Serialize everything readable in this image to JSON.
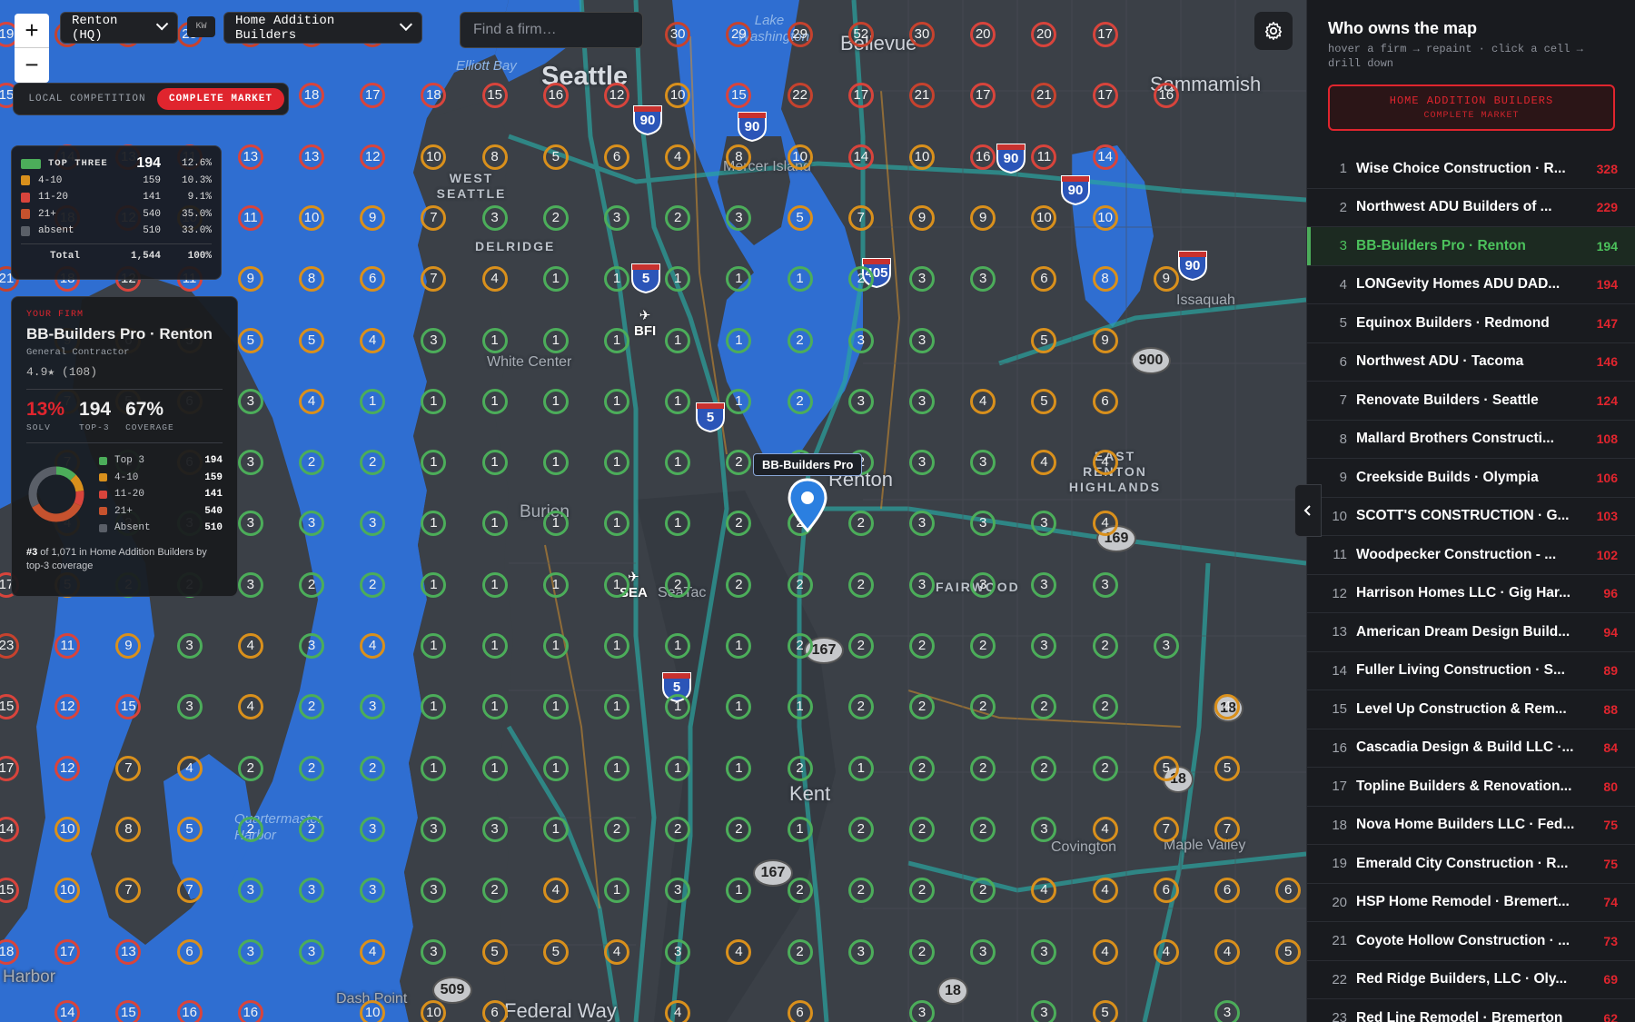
{
  "map": {
    "region_selector": "Renton (HQ)",
    "kw_badge": "KW",
    "category_selector": "Home Addition Builders",
    "search_placeholder": "Find a firm…",
    "mode_local": "LOCAL COMPETITION",
    "mode_complete": "COMPLETE MARKET",
    "zoom_in": "+",
    "zoom_out": "−",
    "pin_label": "BB-Builders Pro",
    "places": [
      {
        "name": "Seattle",
        "cls": "big"
      },
      {
        "name": "Bellevue",
        "cls": "med"
      },
      {
        "name": "Sammamish",
        "cls": "med"
      },
      {
        "name": "Renton",
        "cls": "med"
      },
      {
        "name": "Burien",
        "cls": "faint"
      },
      {
        "name": "Kent",
        "cls": "med"
      },
      {
        "name": "Issaquah",
        "cls": "faint"
      },
      {
        "name": "WEST SEATTLE",
        "cls": "small"
      },
      {
        "name": "DELRIDGE",
        "cls": "small"
      },
      {
        "name": "EAST RENTON HIGHLANDS",
        "cls": "small"
      },
      {
        "name": "FAIRWOOD",
        "cls": "small"
      },
      {
        "name": "White Center",
        "cls": "faint"
      },
      {
        "name": "Mercer Island",
        "cls": "faint"
      },
      {
        "name": "SeaTac",
        "cls": "faint"
      },
      {
        "name": "Covington",
        "cls": "faint"
      },
      {
        "name": "Maple Valley",
        "cls": "faint"
      },
      {
        "name": "Federal Way",
        "cls": "med"
      },
      {
        "name": "Dash Point",
        "cls": "faint"
      },
      {
        "name": "Elliott Bay",
        "cls": "water"
      },
      {
        "name": "Lake Washington",
        "cls": "water"
      },
      {
        "name": "Quartermaster Harbor",
        "cls": "water"
      },
      {
        "name": "Harbor",
        "cls": "faint"
      }
    ],
    "airports": [
      "BFI",
      "SEA"
    ],
    "interstates": [
      "90",
      "90",
      "90",
      "90",
      "90",
      "5",
      "5",
      "5",
      "405"
    ],
    "state_routes": [
      "900",
      "169",
      "167",
      "167",
      "509",
      "18",
      "18",
      "18"
    ],
    "grid": [
      [
        "19",
        "23",
        "26",
        "25",
        "28",
        "22",
        "23",
        "",
        "20",
        "",
        "21",
        "30",
        "29",
        "29",
        "52",
        "30",
        "20",
        "20",
        "17"
      ],
      [
        "15",
        "",
        "",
        "23",
        "15",
        "18",
        "17",
        "18",
        "15",
        "16",
        "12",
        "10",
        "15",
        "22",
        "17",
        "21",
        "17",
        "21",
        "17",
        "16"
      ],
      [
        "",
        "14",
        "13",
        "11",
        "13",
        "13",
        "12",
        "10",
        "8",
        "5",
        "6",
        "4",
        "8",
        "10",
        "14",
        "10",
        "16",
        "11",
        "14"
      ],
      [
        "",
        "18",
        "12",
        "10",
        "11",
        "10",
        "9",
        "7",
        "3",
        "2",
        "3",
        "2",
        "3",
        "5",
        "7",
        "9",
        "9",
        "10",
        "10"
      ],
      [
        "21",
        "18",
        "12",
        "11",
        "9",
        "8",
        "6",
        "7",
        "4",
        "1",
        "1",
        "1",
        "1",
        "1",
        "2",
        "3",
        "3",
        "6",
        "8",
        "9"
      ],
      [
        "",
        "9",
        "6",
        "5",
        "5",
        "5",
        "4",
        "3",
        "1",
        "1",
        "1",
        "1",
        "1",
        "2",
        "3",
        "3",
        "",
        "5",
        "9"
      ],
      [
        "",
        "7",
        "5",
        "6",
        "3",
        "4",
        "1",
        "1",
        "1",
        "1",
        "1",
        "1",
        "1",
        "2",
        "3",
        "3",
        "4",
        "5",
        "6"
      ],
      [
        "",
        "7",
        "3",
        "6",
        "3",
        "2",
        "2",
        "1",
        "1",
        "1",
        "1",
        "1",
        "2",
        "3",
        "2",
        "3",
        "3",
        "4",
        "4"
      ],
      [
        "",
        "4",
        "2",
        "3",
        "3",
        "3",
        "3",
        "1",
        "1",
        "1",
        "1",
        "1",
        "2",
        "2",
        "2",
        "3",
        "3",
        "3",
        "4"
      ],
      [
        "17",
        "5",
        "2",
        "2",
        "3",
        "2",
        "2",
        "1",
        "1",
        "1",
        "1",
        "2",
        "2",
        "2",
        "2",
        "3",
        "3",
        "3",
        "3"
      ],
      [
        "23",
        "11",
        "9",
        "3",
        "4",
        "3",
        "4",
        "1",
        "1",
        "1",
        "1",
        "1",
        "1",
        "2",
        "2",
        "2",
        "2",
        "3",
        "2",
        "3"
      ],
      [
        "15",
        "12",
        "15",
        "3",
        "4",
        "2",
        "3",
        "1",
        "1",
        "1",
        "1",
        "1",
        "1",
        "1",
        "2",
        "2",
        "2",
        "2",
        "2",
        "",
        "4"
      ],
      [
        "17",
        "12",
        "7",
        "4",
        "2",
        "2",
        "2",
        "1",
        "1",
        "1",
        "1",
        "1",
        "1",
        "2",
        "1",
        "2",
        "2",
        "2",
        "2",
        "5",
        "5"
      ],
      [
        "14",
        "10",
        "8",
        "5",
        "2",
        "2",
        "3",
        "3",
        "3",
        "1",
        "2",
        "2",
        "2",
        "1",
        "2",
        "2",
        "2",
        "3",
        "4",
        "7",
        "7"
      ],
      [
        "15",
        "10",
        "7",
        "7",
        "3",
        "3",
        "3",
        "3",
        "2",
        "4",
        "1",
        "3",
        "1",
        "2",
        "2",
        "2",
        "2",
        "4",
        "4",
        "6",
        "6",
        "6"
      ],
      [
        "18",
        "17",
        "13",
        "6",
        "3",
        "3",
        "4",
        "3",
        "5",
        "5",
        "4",
        "3",
        "4",
        "2",
        "3",
        "2",
        "3",
        "3",
        "4",
        "4",
        "4",
        "5"
      ],
      [
        "",
        "14",
        "15",
        "16",
        "16",
        "",
        "10",
        "10",
        "6",
        "",
        "",
        "4",
        "",
        "6",
        "",
        "3",
        "",
        "3",
        "5",
        "",
        "3",
        ""
      ]
    ]
  },
  "legend": {
    "rows": [
      {
        "label": "TOP THREE",
        "count": "194",
        "pct": "12.6%",
        "color": "#4cad5a"
      },
      {
        "label": "4-10",
        "count": "159",
        "pct": "10.3%",
        "color": "#d9901c"
      },
      {
        "label": "11-20",
        "count": "141",
        "pct": "9.1%",
        "color": "#d8443c"
      },
      {
        "label": "21+",
        "count": "540",
        "pct": "35.0%",
        "color": "#c6522e"
      },
      {
        "label": "absent",
        "count": "510",
        "pct": "33.0%",
        "color": "#5a5f68"
      }
    ],
    "total_label": "Total",
    "total_count": "1,544",
    "total_pct": "100%"
  },
  "firm": {
    "eyebrow": "YOUR FIRM",
    "name": "BB-Builders Pro · Renton",
    "category": "General Contractor",
    "rating": "4.9★ (108)",
    "solv": "13%",
    "solv_label": "SOLV",
    "top3": "194",
    "top3_label": "TOP-3",
    "coverage": "67%",
    "coverage_label": "COVERAGE",
    "breakdown": [
      {
        "label": "Top 3",
        "value": 194,
        "color": "#4cad5a"
      },
      {
        "label": "4-10",
        "value": 159,
        "color": "#d9901c"
      },
      {
        "label": "11-20",
        "value": 141,
        "color": "#d8443c"
      },
      {
        "label": "21+",
        "value": 540,
        "color": "#c6522e"
      },
      {
        "label": "Absent",
        "value": 510,
        "color": "#5a5f68"
      }
    ],
    "foot_rank": "#3",
    "foot_text": " of 1,071 in Home Addition Builders by top-3 coverage"
  },
  "sidebar": {
    "title": "Who owns the map",
    "subtitle": "hover a firm → repaint · click a cell → drill down",
    "button_line1": "HOME ADDITION BUILDERS",
    "button_line2": "COMPLETE MARKET",
    "active_rank": 3,
    "firms": [
      {
        "rank": "1",
        "name": "Wise Choice Construction · R...",
        "score": "328"
      },
      {
        "rank": "2",
        "name": "Northwest ADU Builders of ...",
        "score": "229"
      },
      {
        "rank": "3",
        "name": "BB-Builders Pro · Renton",
        "score": "194"
      },
      {
        "rank": "4",
        "name": "LONGevity Homes ADU DAD...",
        "score": "194"
      },
      {
        "rank": "5",
        "name": "Equinox Builders · Redmond",
        "score": "147"
      },
      {
        "rank": "6",
        "name": "Northwest ADU · Tacoma",
        "score": "146"
      },
      {
        "rank": "7",
        "name": "Renovate Builders · Seattle",
        "score": "124"
      },
      {
        "rank": "8",
        "name": "Mallard Brothers Constructi...",
        "score": "108"
      },
      {
        "rank": "9",
        "name": "Creekside Builds · Olympia",
        "score": "106"
      },
      {
        "rank": "10",
        "name": "SCOTT'S CONSTRUCTION · G...",
        "score": "103"
      },
      {
        "rank": "11",
        "name": "Woodpecker Construction - ...",
        "score": "102"
      },
      {
        "rank": "12",
        "name": "Harrison Homes LLC · Gig Har...",
        "score": "96"
      },
      {
        "rank": "13",
        "name": "American Dream Design Build...",
        "score": "94"
      },
      {
        "rank": "14",
        "name": "Fuller Living Construction · S...",
        "score": "89"
      },
      {
        "rank": "15",
        "name": "Level Up Construction & Rem...",
        "score": "88"
      },
      {
        "rank": "16",
        "name": "Cascadia Design & Build LLC ·...",
        "score": "84"
      },
      {
        "rank": "17",
        "name": "Topline Builders & Renovation...",
        "score": "80"
      },
      {
        "rank": "18",
        "name": "Nova Home Builders LLC · Fed...",
        "score": "75"
      },
      {
        "rank": "19",
        "name": "Emerald City Construction · R...",
        "score": "75"
      },
      {
        "rank": "20",
        "name": "HSP Home Remodel · Bremert...",
        "score": "74"
      },
      {
        "rank": "21",
        "name": "Coyote Hollow Construction · ...",
        "score": "73"
      },
      {
        "rank": "22",
        "name": "Red Ridge Builders, LLC · Oly...",
        "score": "69"
      },
      {
        "rank": "23",
        "name": "Red Line Remodel · Bremerton",
        "score": "62"
      }
    ]
  }
}
